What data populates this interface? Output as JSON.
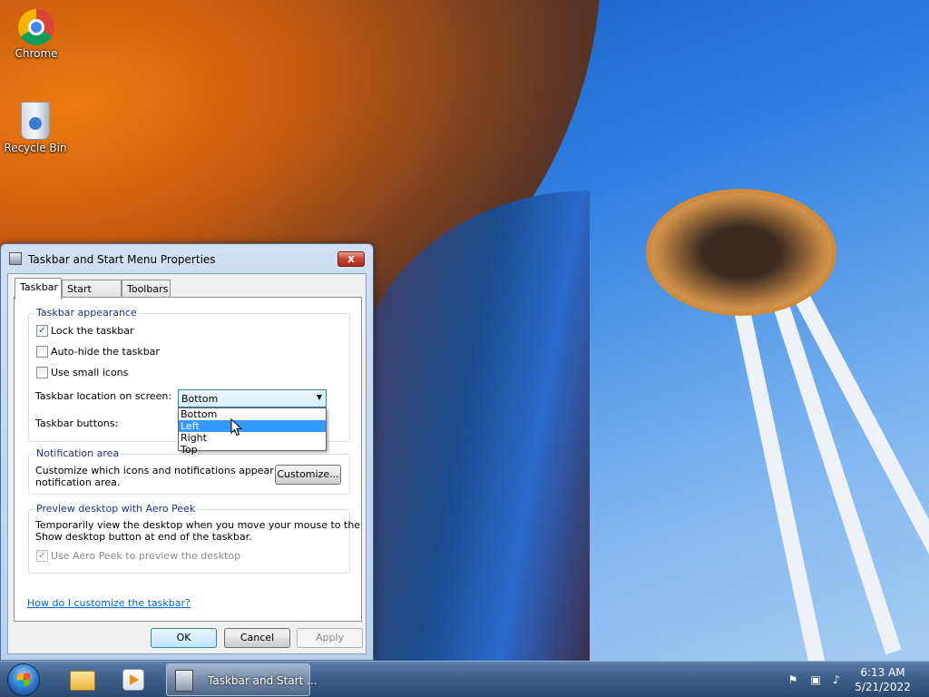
{
  "desktop": {
    "icons": [
      {
        "label": "Chrome",
        "icon": "chrome-icon"
      },
      {
        "label": "Recycle Bin",
        "icon": "recycle-bin-icon"
      }
    ]
  },
  "dialog": {
    "title": "Taskbar and Start Menu Properties",
    "close_label": "x",
    "tabs": [
      {
        "label": "Taskbar",
        "active": true
      },
      {
        "label": "Start Menu",
        "active": false
      },
      {
        "label": "Toolbars",
        "active": false
      }
    ],
    "appearance": {
      "title": "Taskbar appearance",
      "lock_label": "Lock the taskbar",
      "lock_checked": true,
      "autohide_label": "Auto-hide the taskbar",
      "autohide_checked": false,
      "small_icons_label": "Use small icons",
      "small_icons_checked": false,
      "location_label": "Taskbar location on screen:",
      "location_value": "Bottom",
      "location_options": [
        "Bottom",
        "Left",
        "Right",
        "Top"
      ],
      "location_highlighted": "Left",
      "buttons_label": "Taskbar buttons:"
    },
    "notification": {
      "title": "Notification area",
      "text_line1": "Customize which icons and notifications appear in the",
      "text_line2": "notification area.",
      "customize_label": "Customize..."
    },
    "aero_peek": {
      "title": "Preview desktop with Aero Peek",
      "text_line1": "Temporarily view the desktop when you move your mouse to the",
      "text_line2": "Show desktop button at end of the taskbar.",
      "checkbox_label": "Use Aero Peek to preview the desktop",
      "checked": true
    },
    "help_link": "How do I customize the taskbar?",
    "ok_label": "OK",
    "cancel_label": "Cancel",
    "apply_label": "Apply"
  },
  "taskbar": {
    "task_label": "Taskbar and Start ...",
    "clock_time": "6:13 AM",
    "clock_date": "5/21/2022"
  },
  "colors": {
    "accent": "#3399ff",
    "group_title": "#1e3287",
    "link": "#0066cc"
  }
}
